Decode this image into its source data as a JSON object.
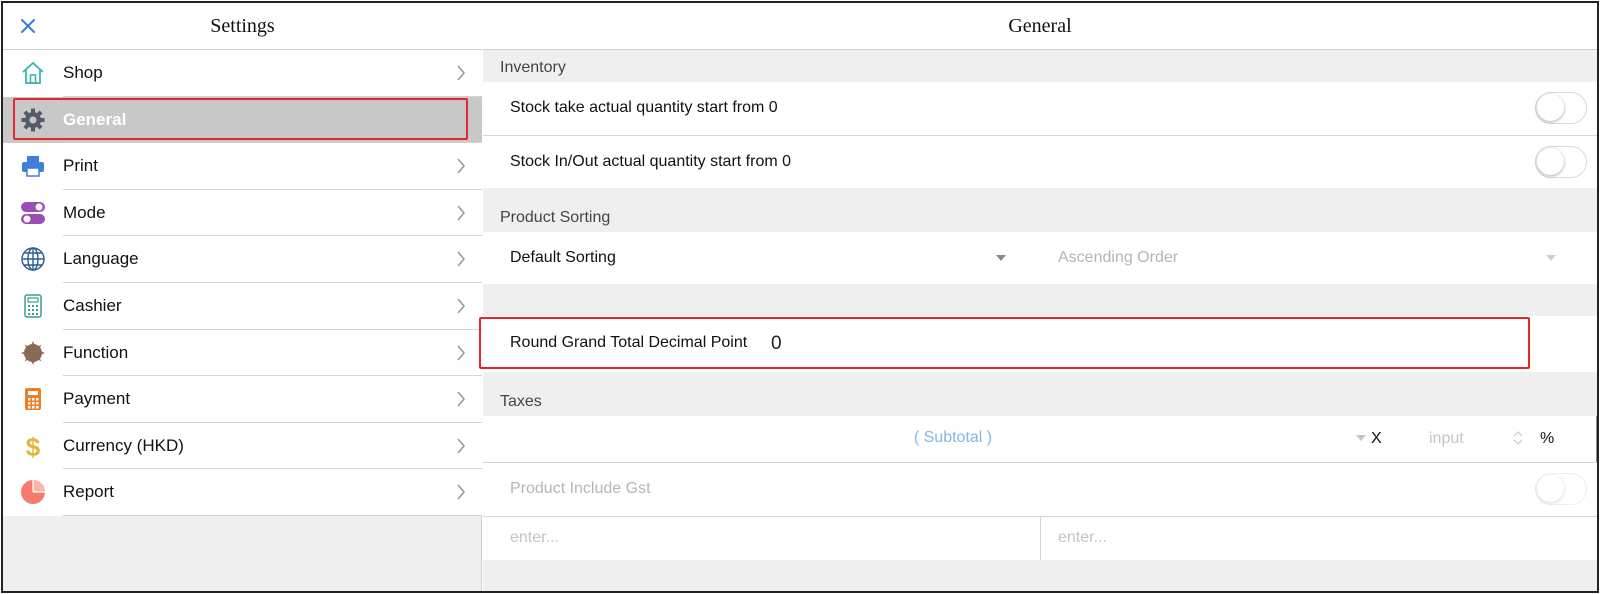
{
  "sidebar": {
    "title": "Settings",
    "close_icon": "close-icon",
    "items": [
      {
        "label": "Shop",
        "icon": "home-icon",
        "active": false
      },
      {
        "label": "General",
        "icon": "gear-icon",
        "active": true
      },
      {
        "label": "Print",
        "icon": "printer-icon",
        "active": false
      },
      {
        "label": "Mode",
        "icon": "toggle-mode-icon",
        "active": false
      },
      {
        "label": "Language",
        "icon": "globe-icon",
        "active": false
      },
      {
        "label": "Cashier",
        "icon": "cashier-calculator-icon",
        "active": false
      },
      {
        "label": "Function",
        "icon": "function-gear-icon",
        "active": false
      },
      {
        "label": "Payment",
        "icon": "payment-calculator-icon",
        "active": false
      },
      {
        "label": "Currency (HKD)",
        "icon": "dollar-icon",
        "active": false
      },
      {
        "label": "Report",
        "icon": "pie-chart-icon",
        "active": false
      }
    ]
  },
  "main": {
    "title": "General",
    "inventory": {
      "label": "Inventory",
      "rows": [
        {
          "label": "Stock take actual quantity start from 0",
          "enabled": false
        },
        {
          "label": "Stock In/Out actual quantity start from 0",
          "enabled": false
        }
      ]
    },
    "product_sorting": {
      "label": "Product Sorting",
      "sort_by": "Default Sorting",
      "order": "Ascending Order"
    },
    "round": {
      "label": "Round Grand Total Decimal Point",
      "value": "0"
    },
    "taxes": {
      "label": "Taxes",
      "base": "( Subtotal )",
      "multiply": "X",
      "rate_placeholder": "input",
      "percent": "%",
      "include_gst_label": "Product Include Gst",
      "include_gst_enabled": false,
      "field1_placeholder": "enter...",
      "field2_placeholder": "enter..."
    }
  },
  "colors": {
    "highlight": "#e5262a",
    "active_item_bg": "#c8c8c8",
    "subtotal_text": "#7fb8e6"
  }
}
